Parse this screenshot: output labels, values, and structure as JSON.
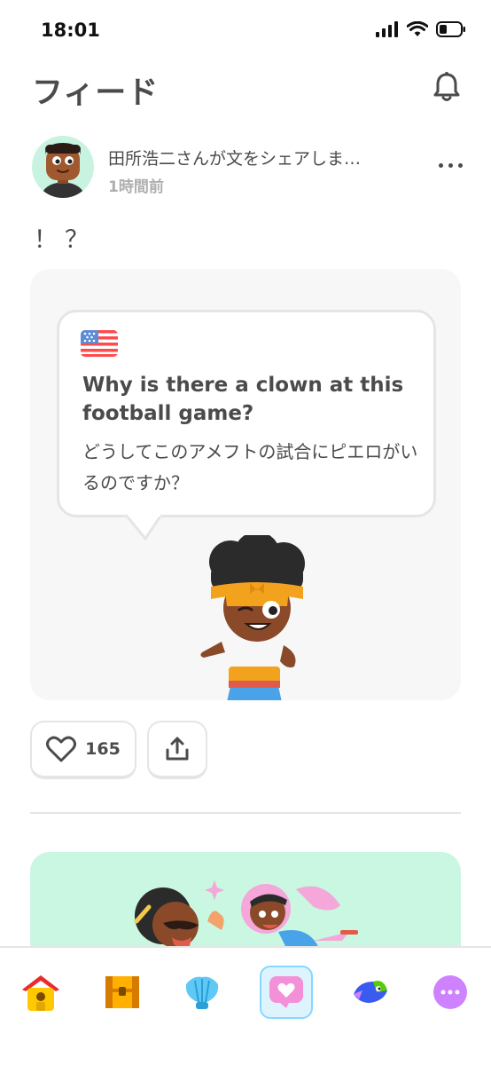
{
  "status_bar": {
    "time": "18:01"
  },
  "header": {
    "title": "フィード",
    "bell_icon": "bell-icon"
  },
  "post": {
    "author_line": "田所浩二さんが文をシェアしま…",
    "time_ago": "1時間前",
    "text": "！？",
    "shared_sentence": {
      "language_flag": "us-flag-icon",
      "english": "Why is there a clown at this football game?",
      "japanese": "どうしてこのアメフトの試合にピエロがいるのですか？"
    },
    "likes": "165"
  },
  "tab_bar": {
    "tabs": [
      {
        "name": "home",
        "icon": "home-house-icon"
      },
      {
        "name": "chest",
        "icon": "treasure-chest-icon"
      },
      {
        "name": "shell",
        "icon": "shell-icon"
      },
      {
        "name": "feed",
        "icon": "heart-icon",
        "active": true
      },
      {
        "name": "bird",
        "icon": "bird-icon"
      },
      {
        "name": "more",
        "icon": "more-dots-icon"
      }
    ]
  },
  "colors": {
    "text": "#4b4b4b",
    "muted": "#afafaf",
    "border": "#e5e5e5",
    "card_bg": "#f7f7f7",
    "active_tab_bg": "#ddf4ff",
    "active_tab_border": "#84d8ff",
    "next_card_bg": "#c9f7e2"
  }
}
